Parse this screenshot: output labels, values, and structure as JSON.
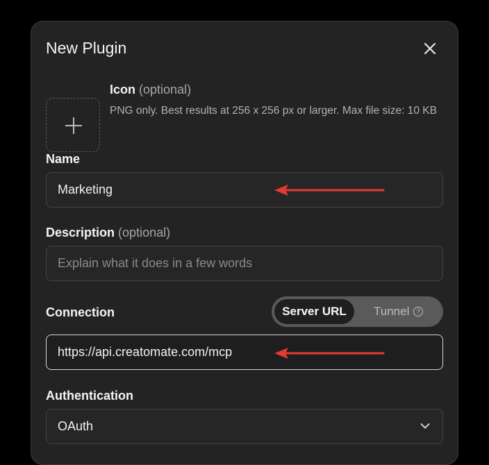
{
  "modal": {
    "title": "New Plugin",
    "icon_section": {
      "label": "Icon",
      "optional": "(optional)",
      "help": "PNG only. Best results at 256 x 256 px or larger. Max file size: 10 KB"
    },
    "name": {
      "label": "Name",
      "value": "Marketing"
    },
    "description": {
      "label": "Description",
      "optional": "(optional)",
      "placeholder": "Explain what it does in a few words"
    },
    "connection": {
      "label": "Connection",
      "tabs": [
        {
          "label": "Server URL",
          "active": true
        },
        {
          "label": "Tunnel",
          "active": false
        }
      ],
      "url_value": "https://api.creatomate.com/mcp"
    },
    "authentication": {
      "label": "Authentication",
      "selected": "OAuth"
    }
  },
  "colors": {
    "annotation_arrow": "#e53935",
    "background": "#232323"
  },
  "icons": [
    "close-icon",
    "plus-icon",
    "help-circle-icon",
    "chevron-down-icon",
    "red-arrow-annotation"
  ]
}
